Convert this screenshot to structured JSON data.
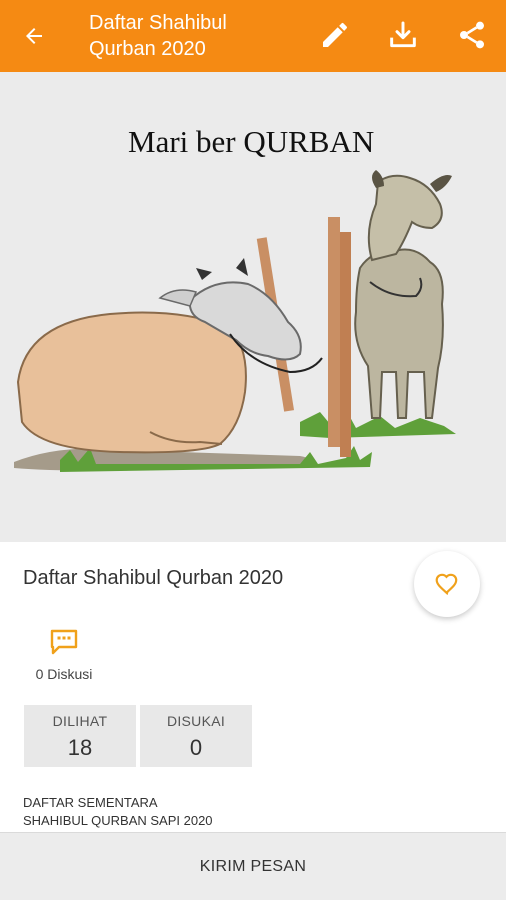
{
  "appbar": {
    "title_line1": "Daftar Shahibul",
    "title_line2": "Qurban 2020",
    "icons": {
      "back": "arrow-left",
      "edit": "pencil",
      "download": "download-tray",
      "share": "share-nodes"
    },
    "color": "#f58a13"
  },
  "hero": {
    "banner_text": "Mari ber QURBAN"
  },
  "document": {
    "title": "Daftar Shahibul Qurban 2020",
    "favorite_icon": "heart-outline",
    "discussion_label": "0 Diskusi",
    "stats": [
      {
        "label": "DILIHAT",
        "value": "18"
      },
      {
        "label": "DISUKAI",
        "value": "0"
      }
    ],
    "description_line1": "DAFTAR SEMENTARA",
    "description_line2": "SHAHIBUL QURBAN SAPI 2020"
  },
  "bottom_bar": {
    "button_label": "KIRIM PESAN"
  },
  "colors": {
    "accent": "#f58a13",
    "icon_orange": "#f0a11b"
  }
}
